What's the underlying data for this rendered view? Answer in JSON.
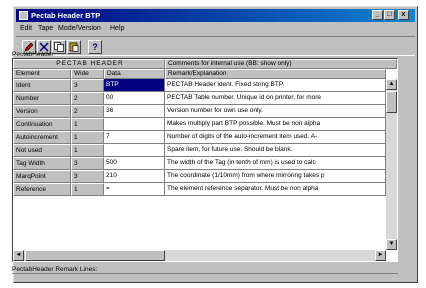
{
  "window": {
    "title": "Pectab Header BTP"
  },
  "title_buttons": {
    "minimize": "_",
    "maximize": "□",
    "close": "x"
  },
  "menu": [
    {
      "label": "Edit"
    },
    {
      "label": "Tape"
    },
    {
      "label": "Mode/Version"
    },
    {
      "label": "Help"
    }
  ],
  "toolbar": {
    "icons": [
      "pencil-icon",
      "delete-icon",
      "copy-icon",
      "paste-icon",
      "help-icon"
    ],
    "help_glyph": "?"
  },
  "section_label": "PectabHeader",
  "grid": {
    "group_header": "PECTAB HEADER",
    "group_note": "Comments for internal use (BB: show only)",
    "columns": [
      "Element",
      "Wide",
      "Data",
      "Remark/Explanation"
    ],
    "rows": [
      {
        "element": "Ident",
        "wide": "3",
        "data": "BTP",
        "remark": "PECTAB Header ident. Fixed string BTP."
      },
      {
        "element": "Number",
        "wide": "2",
        "data": "00",
        "remark": "PECTAB Table number. Unique id on printer, for more"
      },
      {
        "element": "Version",
        "wide": "2",
        "data": "36",
        "remark": "Version number for own use only."
      },
      {
        "element": "Continuation",
        "wide": "1",
        "data": "",
        "remark": "Makes multiply part BTP possible. Must be non alpha"
      },
      {
        "element": "Autoincrement",
        "wide": "1",
        "data": "7",
        "remark": "Number of digits of the auto-increment item used. A-"
      },
      {
        "element": "Not used",
        "wide": "1",
        "data": "",
        "remark": "Spare item, for future use. Should be blank."
      },
      {
        "element": "Tag Width",
        "wide": "3",
        "data": "500",
        "remark": "The width of the Tag (in tenth of mm) is used to calc"
      },
      {
        "element": "MarqPoint",
        "wide": "3",
        "data": "210",
        "remark": "The coordinate (1/10mm) from where mirroring takes p"
      },
      {
        "element": "Reference",
        "wide": "1",
        "data": "=",
        "remark": "The element reference separator. Must be non alpha"
      }
    ]
  },
  "scroll": {
    "up": "▲",
    "down": "▼",
    "left": "◄",
    "right": "►"
  },
  "remark_label": "PectabHeader Remark Lines:"
}
